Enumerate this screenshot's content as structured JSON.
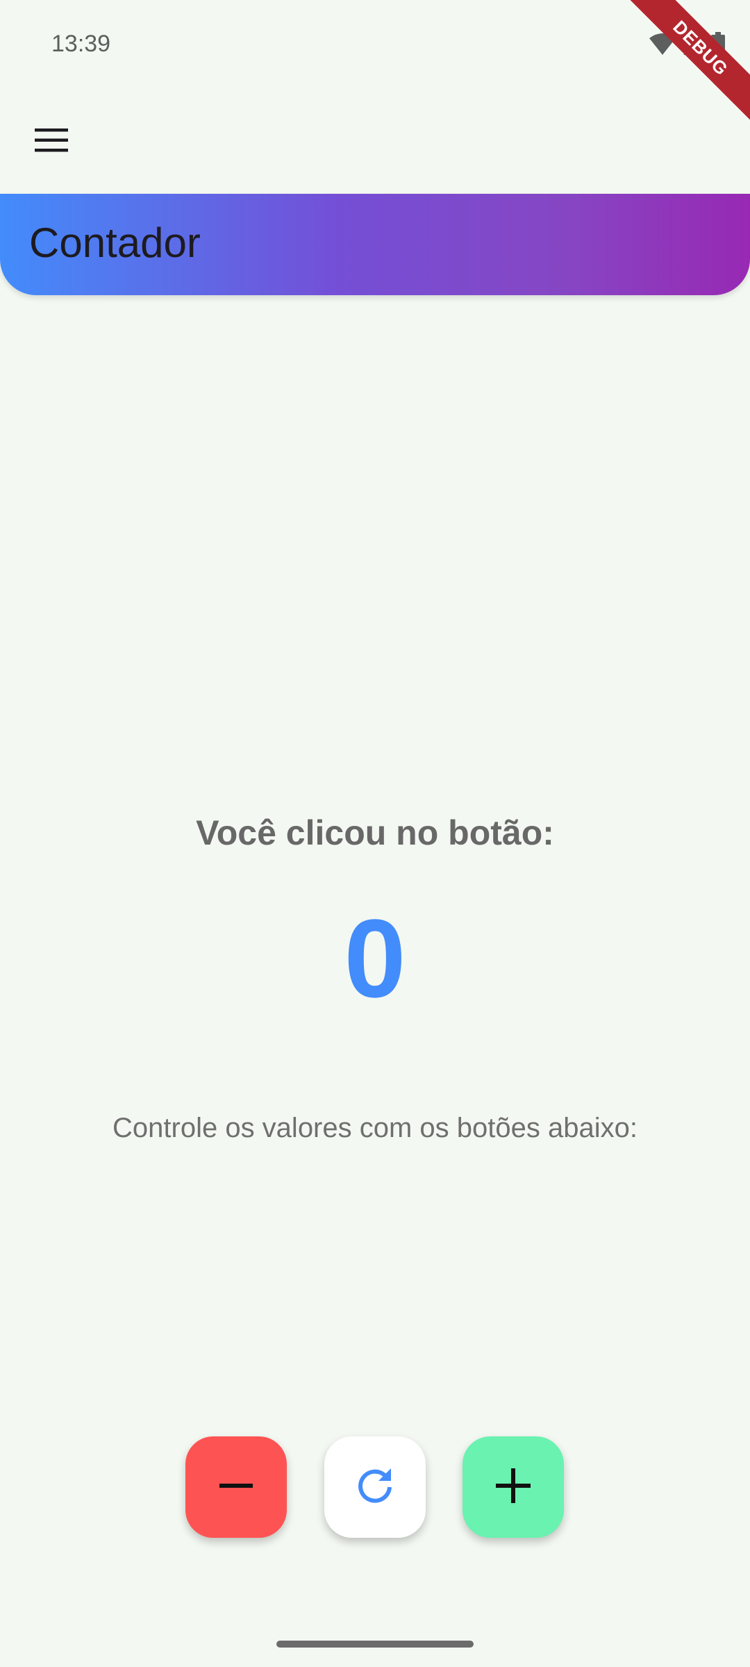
{
  "status_bar": {
    "time": "13:39",
    "icons": [
      "wifi-icon",
      "cellular-signal-icon",
      "battery-icon"
    ]
  },
  "debug_banner": {
    "label": "DEBUG",
    "color": "#b3262e"
  },
  "app_bar": {
    "menu_icon": "hamburger-menu-icon",
    "title": "Contador",
    "gradient_colors": [
      "#438cfb",
      "#744fd6",
      "#9829b4"
    ]
  },
  "counter": {
    "label": "Você clicou no botão:",
    "value": "0",
    "value_color": "#438cfb",
    "hint": "Controle os valores com os botões abaixo:"
  },
  "actions": {
    "decrement": {
      "icon": "minus-icon",
      "color": "#fe5353"
    },
    "reset": {
      "icon": "refresh-icon",
      "color": "#ffffff",
      "icon_color": "#438cfb"
    },
    "increment": {
      "icon": "plus-icon",
      "color": "#69f2b0"
    }
  }
}
